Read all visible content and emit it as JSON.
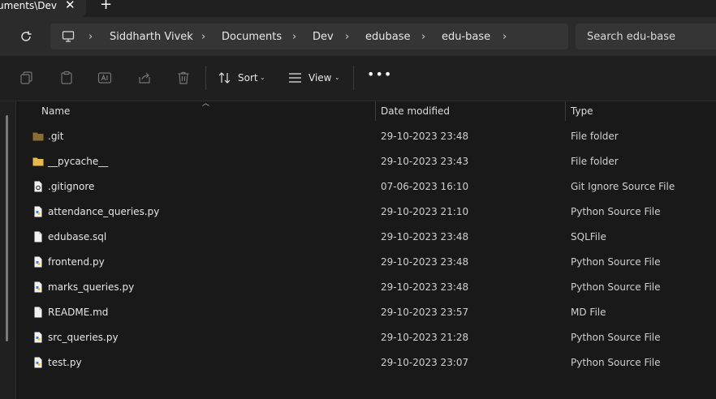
{
  "tab": {
    "title": "Documents\\Dev",
    "close_glyph": "✕",
    "new_tab_glyph": "+"
  },
  "address": {
    "crumbs": [
      "Siddharth Vivek",
      "Documents",
      "Dev",
      "edubase",
      "edu-base"
    ],
    "separator": "›",
    "search_placeholder": "Search edu-base"
  },
  "toolbar": {
    "icons": [
      "copy-icon",
      "paste-icon",
      "rename-icon",
      "share-icon",
      "delete-icon"
    ],
    "sort_label": "Sort",
    "view_label": "View",
    "more_label": "•••"
  },
  "columns": {
    "name": "Name",
    "date": "Date modified",
    "type": "Type"
  },
  "files": [
    {
      "name": ".git",
      "date": "29-10-2023 23:48",
      "type": "File folder",
      "icon": "folder-dark"
    },
    {
      "name": "__pycache__",
      "date": "29-10-2023 23:43",
      "type": "File folder",
      "icon": "folder"
    },
    {
      "name": ".gitignore",
      "date": "07-06-2023 16:10",
      "type": "Git Ignore Source File",
      "icon": "settings-file"
    },
    {
      "name": "attendance_queries.py",
      "date": "29-10-2023 21:10",
      "type": "Python Source File",
      "icon": "python-file"
    },
    {
      "name": "edubase.sql",
      "date": "29-10-2023 23:48",
      "type": "SQLFile",
      "icon": "blank-file"
    },
    {
      "name": "frontend.py",
      "date": "29-10-2023 23:48",
      "type": "Python Source File",
      "icon": "python-file"
    },
    {
      "name": "marks_queries.py",
      "date": "29-10-2023 23:48",
      "type": "Python Source File",
      "icon": "python-file"
    },
    {
      "name": "README.md",
      "date": "29-10-2023 23:57",
      "type": "MD File",
      "icon": "blank-file"
    },
    {
      "name": "src_queries.py",
      "date": "29-10-2023 21:28",
      "type": "Python Source File",
      "icon": "python-file"
    },
    {
      "name": "test.py",
      "date": "29-10-2023 23:07",
      "type": "Python Source File",
      "icon": "python-file"
    }
  ],
  "colors": {
    "folder": "#e8b84a",
    "folder_dark": "#8a6d33",
    "python_accent": "#3b7bd4"
  }
}
